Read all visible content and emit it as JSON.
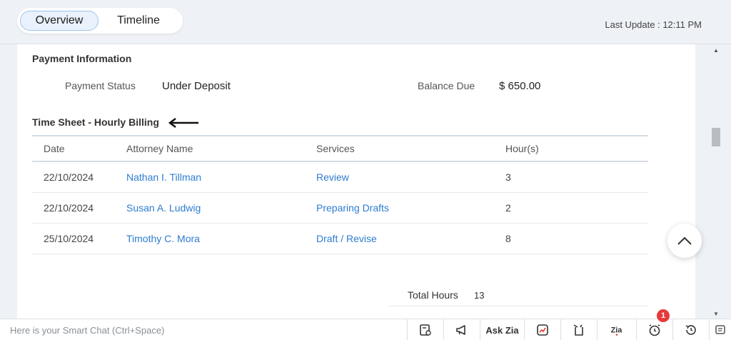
{
  "tabs": [
    {
      "label": "Overview",
      "active": true
    },
    {
      "label": "Timeline",
      "active": false
    }
  ],
  "last_update": "Last Update : 12:11 PM",
  "payment": {
    "title": "Payment Information",
    "status_label": "Payment Status",
    "status_value": "Under Deposit",
    "balance_label": "Balance Due",
    "balance_value": "$ 650.00"
  },
  "timesheet": {
    "title": "Time Sheet - Hourly Billing",
    "columns": [
      "Date",
      "Attorney Name",
      "Services",
      "Hour(s)"
    ],
    "rows": [
      {
        "date": "22/10/2024",
        "attorney": "Nathan I. Tillman",
        "service": "Review",
        "hours": "3"
      },
      {
        "date": "22/10/2024",
        "attorney": "Susan A. Ludwig",
        "service": "Preparing Drafts",
        "hours": "2"
      },
      {
        "date": "25/10/2024",
        "attorney": "Timothy C. Mora",
        "service": "Draft / Revise",
        "hours": "8"
      }
    ],
    "total_label": "Total Hours",
    "total_value": "13"
  },
  "bottom_bar": {
    "smart_chat_placeholder": "Here is your Smart Chat (Ctrl+Space)",
    "ask_zia": "Ask Zia",
    "notification_count": "1",
    "icons": [
      "gallery-icon",
      "megaphone-icon",
      "ask-zia",
      "chart-icon",
      "clipboard-icon",
      "zia-icon",
      "alarm-icon",
      "history-icon",
      "chat-icon"
    ]
  },
  "colors": {
    "link": "#2e7cd1",
    "badge": "#e63a3a",
    "active_tab_border": "#9cc3ea"
  }
}
